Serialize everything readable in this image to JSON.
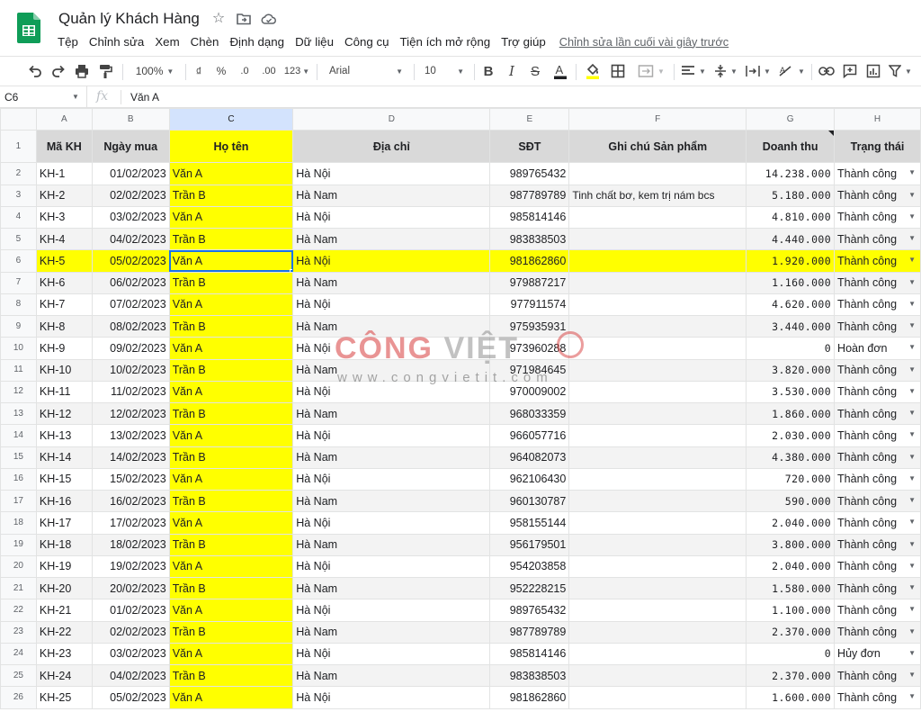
{
  "app": {
    "title": "Quản lý Khách Hàng",
    "last_edit": "Chỉnh sửa lần cuối vài giây trước",
    "menu": [
      "Tệp",
      "Chỉnh sửa",
      "Xem",
      "Chèn",
      "Định dạng",
      "Dữ liệu",
      "Công cụ",
      "Tiện ích mở rộng",
      "Trợ giúp"
    ]
  },
  "toolbar": {
    "zoom": "100%",
    "currency": "₫",
    "percent": "%",
    "dec_decrease": ".0",
    "dec_increase": ".00",
    "more_formats": "123",
    "font": "Arial",
    "font_size": "10"
  },
  "formula_bar": {
    "cell_ref": "C6",
    "fx": "fx",
    "value": "Văn A"
  },
  "columns": [
    "A",
    "B",
    "C",
    "D",
    "E",
    "F",
    "G",
    "H"
  ],
  "header_row": {
    "row_number": "1",
    "cells": [
      "Mã KH",
      "Ngày mua",
      "Họ tên",
      "Địa chỉ",
      "SĐT",
      "Ghi chú Sản phẩm",
      "Doanh thu",
      "Trạng thái"
    ]
  },
  "rows": [
    {
      "n": "2",
      "id": "KH-1",
      "date": "01/02/2023",
      "name": "Văn A",
      "addr": "Hà Nội",
      "phone": "989765432",
      "note": "",
      "rev": "14.238.000",
      "status": "Thành công"
    },
    {
      "n": "3",
      "id": "KH-2",
      "date": "02/02/2023",
      "name": "Trần B",
      "addr": "Hà Nam",
      "phone": "987789789",
      "note": "Tinh chất bơ, kem trị nám bcs",
      "rev": "5.180.000",
      "status": "Thành công"
    },
    {
      "n": "4",
      "id": "KH-3",
      "date": "03/02/2023",
      "name": "Văn A",
      "addr": "Hà Nội",
      "phone": "985814146",
      "note": "",
      "rev": "4.810.000",
      "status": "Thành công"
    },
    {
      "n": "5",
      "id": "KH-4",
      "date": "04/02/2023",
      "name": "Trần B",
      "addr": "Hà Nam",
      "phone": "983838503",
      "note": "",
      "rev": "4.440.000",
      "status": "Thành công"
    },
    {
      "n": "6",
      "id": "KH-5",
      "date": "05/02/2023",
      "name": "Văn A",
      "addr": "Hà Nội",
      "phone": "981862860",
      "note": "",
      "rev": "1.920.000",
      "status": "Thành công"
    },
    {
      "n": "7",
      "id": "KH-6",
      "date": "06/02/2023",
      "name": "Trần B",
      "addr": "Hà Nam",
      "phone": "979887217",
      "note": "",
      "rev": "1.160.000",
      "status": "Thành công"
    },
    {
      "n": "8",
      "id": "KH-7",
      "date": "07/02/2023",
      "name": "Văn A",
      "addr": "Hà Nội",
      "phone": "977911574",
      "note": "",
      "rev": "4.620.000",
      "status": "Thành công"
    },
    {
      "n": "9",
      "id": "KH-8",
      "date": "08/02/2023",
      "name": "Trần B",
      "addr": "Hà Nam",
      "phone": "975935931",
      "note": "",
      "rev": "3.440.000",
      "status": "Thành công"
    },
    {
      "n": "10",
      "id": "KH-9",
      "date": "09/02/2023",
      "name": "Văn A",
      "addr": "Hà Nội",
      "phone": "973960288",
      "note": "",
      "rev": "0",
      "status": "Hoàn đơn"
    },
    {
      "n": "11",
      "id": "KH-10",
      "date": "10/02/2023",
      "name": "Trần B",
      "addr": "Hà Nam",
      "phone": "971984645",
      "note": "",
      "rev": "3.820.000",
      "status": "Thành công"
    },
    {
      "n": "12",
      "id": "KH-11",
      "date": "11/02/2023",
      "name": "Văn A",
      "addr": "Hà Nội",
      "phone": "970009002",
      "note": "",
      "rev": "3.530.000",
      "status": "Thành công"
    },
    {
      "n": "13",
      "id": "KH-12",
      "date": "12/02/2023",
      "name": "Trần B",
      "addr": "Hà Nam",
      "phone": "968033359",
      "note": "",
      "rev": "1.860.000",
      "status": "Thành công"
    },
    {
      "n": "14",
      "id": "KH-13",
      "date": "13/02/2023",
      "name": "Văn A",
      "addr": "Hà Nội",
      "phone": "966057716",
      "note": "",
      "rev": "2.030.000",
      "status": "Thành công"
    },
    {
      "n": "15",
      "id": "KH-14",
      "date": "14/02/2023",
      "name": "Trần B",
      "addr": "Hà Nam",
      "phone": "964082073",
      "note": "",
      "rev": "4.380.000",
      "status": "Thành công"
    },
    {
      "n": "16",
      "id": "KH-15",
      "date": "15/02/2023",
      "name": "Văn A",
      "addr": "Hà Nội",
      "phone": "962106430",
      "note": "",
      "rev": "720.000",
      "status": "Thành công"
    },
    {
      "n": "17",
      "id": "KH-16",
      "date": "16/02/2023",
      "name": "Trần B",
      "addr": "Hà Nam",
      "phone": "960130787",
      "note": "",
      "rev": "590.000",
      "status": "Thành công"
    },
    {
      "n": "18",
      "id": "KH-17",
      "date": "17/02/2023",
      "name": "Văn A",
      "addr": "Hà Nội",
      "phone": "958155144",
      "note": "",
      "rev": "2.040.000",
      "status": "Thành công"
    },
    {
      "n": "19",
      "id": "KH-18",
      "date": "18/02/2023",
      "name": "Trần B",
      "addr": "Hà Nam",
      "phone": "956179501",
      "note": "",
      "rev": "3.800.000",
      "status": "Thành công"
    },
    {
      "n": "20",
      "id": "KH-19",
      "date": "19/02/2023",
      "name": "Văn A",
      "addr": "Hà Nội",
      "phone": "954203858",
      "note": "",
      "rev": "2.040.000",
      "status": "Thành công"
    },
    {
      "n": "21",
      "id": "KH-20",
      "date": "20/02/2023",
      "name": "Trần B",
      "addr": "Hà Nam",
      "phone": "952228215",
      "note": "",
      "rev": "1.580.000",
      "status": "Thành công"
    },
    {
      "n": "22",
      "id": "KH-21",
      "date": "01/02/2023",
      "name": "Văn A",
      "addr": "Hà Nội",
      "phone": "989765432",
      "note": "",
      "rev": "1.100.000",
      "status": "Thành công"
    },
    {
      "n": "23",
      "id": "KH-22",
      "date": "02/02/2023",
      "name": "Trần B",
      "addr": "Hà Nam",
      "phone": "987789789",
      "note": "",
      "rev": "2.370.000",
      "status": "Thành công"
    },
    {
      "n": "24",
      "id": "KH-23",
      "date": "03/02/2023",
      "name": "Văn A",
      "addr": "Hà Nội",
      "phone": "985814146",
      "note": "",
      "rev": "0",
      "status": "Hủy đơn"
    },
    {
      "n": "25",
      "id": "KH-24",
      "date": "04/02/2023",
      "name": "Trần B",
      "addr": "Hà Nam",
      "phone": "983838503",
      "note": "",
      "rev": "2.370.000",
      "status": "Thành công"
    },
    {
      "n": "26",
      "id": "KH-25",
      "date": "05/02/2023",
      "name": "Văn A",
      "addr": "Hà Nội",
      "phone": "981862860",
      "note": "",
      "rev": "1.600.000",
      "status": "Thành công"
    }
  ],
  "watermark": {
    "brand_a": "CÔNG",
    "brand_b": "VIỆT",
    "url": "www.congvietit.com"
  },
  "colors": {
    "highlight": "#ffff00",
    "header_fill": "#d9d9d9",
    "selection": "#1a73e8",
    "sheets_green": "#0f9d58"
  }
}
